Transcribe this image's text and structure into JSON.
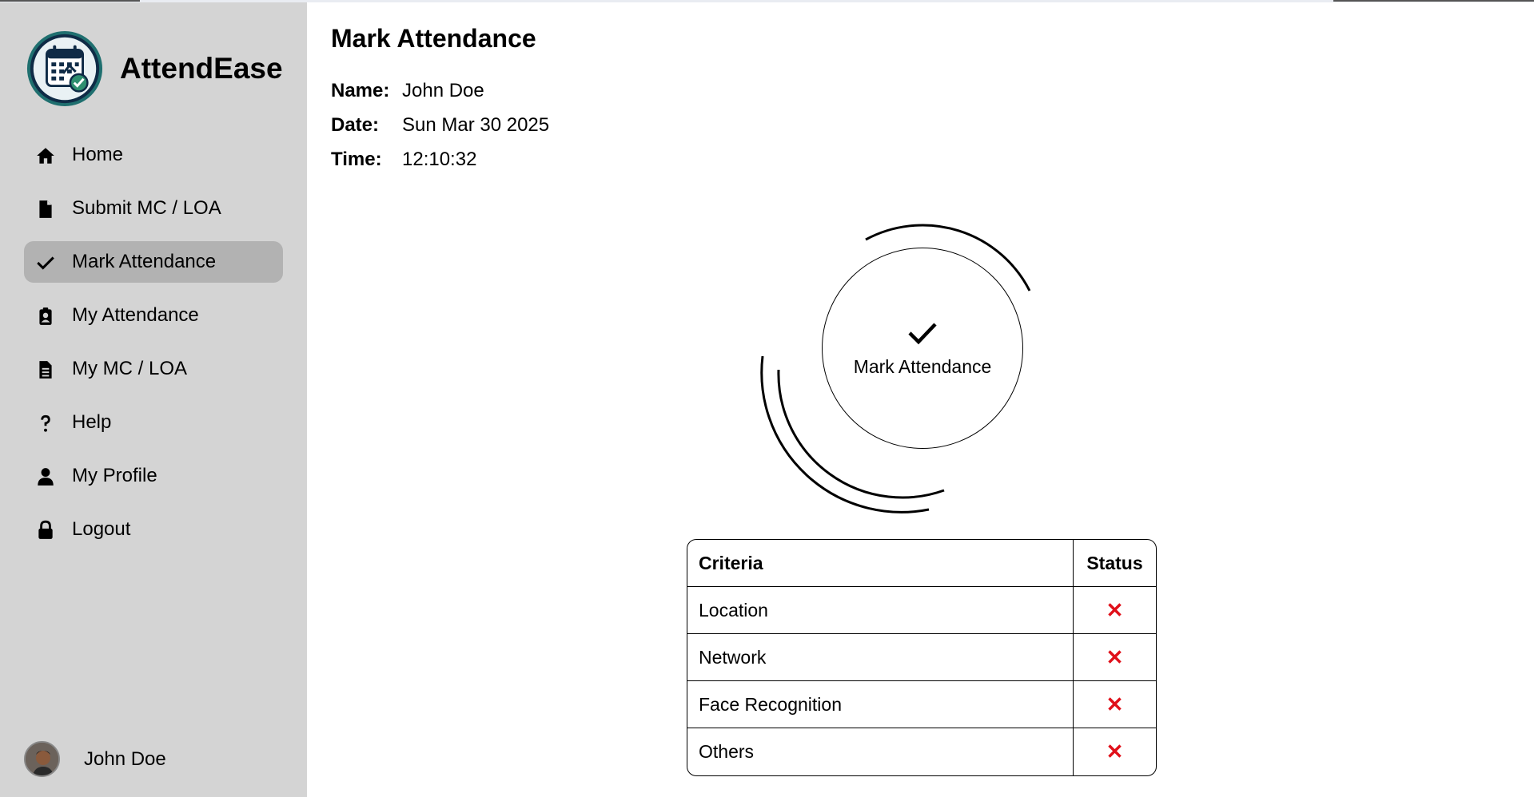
{
  "app": {
    "name": "AttendEase",
    "logo_icon": "calendar-check-logo"
  },
  "sidebar": {
    "items": [
      {
        "label": "Home",
        "icon": "home-icon",
        "active": false
      },
      {
        "label": "Submit MC / LOA",
        "icon": "file-icon",
        "active": false
      },
      {
        "label": "Mark Attendance",
        "icon": "check-icon",
        "active": true
      },
      {
        "label": "My Attendance",
        "icon": "clipboard-user-icon",
        "active": false
      },
      {
        "label": "My MC / LOA",
        "icon": "file-lines-icon",
        "active": false
      },
      {
        "label": "Help",
        "icon": "question-icon",
        "active": false
      },
      {
        "label": "My Profile",
        "icon": "user-icon",
        "active": false
      },
      {
        "label": "Logout",
        "icon": "lock-icon",
        "active": false
      }
    ],
    "user": {
      "name": "John Doe"
    }
  },
  "main": {
    "title": "Mark Attendance",
    "info": {
      "name_label": "Name:",
      "name_value": "John Doe",
      "date_label": "Date:",
      "date_value": "Sun Mar 30 2025",
      "time_label": "Time:",
      "time_value": "12:10:32"
    },
    "mark_button": {
      "label": "Mark Attendance",
      "icon": "check-icon"
    },
    "criteria_table": {
      "headers": [
        "Criteria",
        "Status"
      ],
      "rows": [
        {
          "criteria": "Location",
          "status": "✕"
        },
        {
          "criteria": "Network",
          "status": "✕"
        },
        {
          "criteria": "Face Recognition",
          "status": "✕"
        },
        {
          "criteria": "Others",
          "status": "✕"
        }
      ]
    }
  },
  "colors": {
    "sidebar_bg": "#d4d4d4",
    "active_item_bg": "#b2b2b2",
    "fail_status": "#e0101a"
  }
}
